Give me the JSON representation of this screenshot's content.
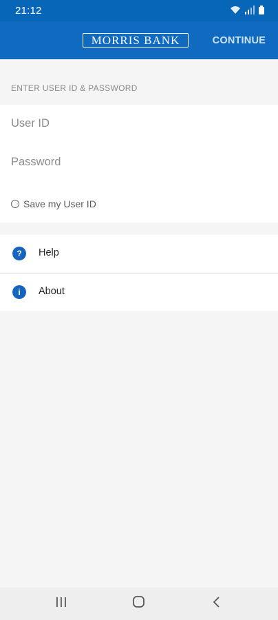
{
  "status_bar": {
    "time": "21:12",
    "icons": [
      "wifi-icon",
      "signal-icon",
      "battery-icon"
    ]
  },
  "header": {
    "logo_text": "MORRIS BANK",
    "continue_label": "CONTINUE"
  },
  "login": {
    "section_title": "ENTER USER ID & PASSWORD",
    "user_id_placeholder": "User ID",
    "user_id_value": "",
    "password_placeholder": "Password",
    "password_value": "",
    "save_user_id_label": "Save my User ID",
    "save_user_id_checked": false
  },
  "menu": {
    "items": [
      {
        "label": "Help",
        "icon": "help-icon",
        "glyph": "?"
      },
      {
        "label": "About",
        "icon": "info-icon",
        "glyph": "i"
      }
    ]
  },
  "nav_bar": {
    "buttons": [
      "recent-apps-icon",
      "home-icon",
      "back-icon"
    ]
  },
  "colors": {
    "primary": "#0f6ac0",
    "status_bar": "#0866b9",
    "background": "#f5f5f5",
    "icon_blue": "#1565c0"
  }
}
